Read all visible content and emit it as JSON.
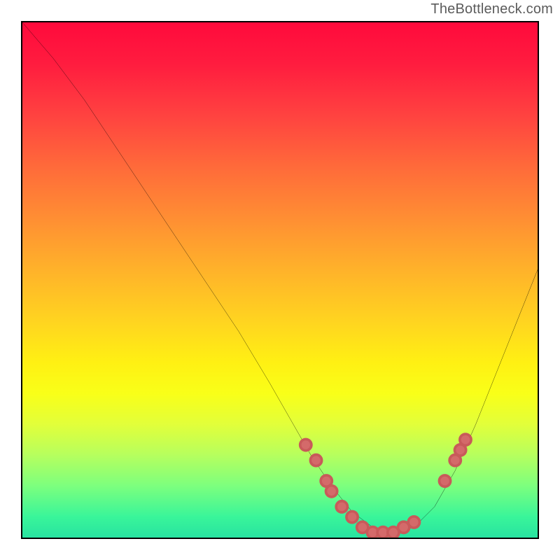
{
  "watermark": "TheBottleneck.com",
  "chart_data": {
    "type": "line",
    "title": "",
    "xlabel": "",
    "ylabel": "",
    "xlim": [
      0,
      100
    ],
    "ylim": [
      0,
      100
    ],
    "grid": false,
    "legend": false,
    "series": [
      {
        "name": "curve",
        "x": [
          0,
          6,
          12,
          18,
          24,
          30,
          36,
          42,
          48,
          52,
          56,
          60,
          64,
          68,
          72,
          76,
          80,
          84,
          88,
          92,
          96,
          100
        ],
        "y": [
          100,
          93,
          85,
          76,
          67,
          58,
          49,
          40,
          30,
          23,
          16,
          10,
          5,
          2,
          1,
          2,
          6,
          13,
          22,
          32,
          42,
          52
        ]
      }
    ],
    "scatter": {
      "name": "dots",
      "x": [
        55,
        57,
        59,
        60,
        62,
        64,
        66,
        68,
        70,
        72,
        74,
        76,
        82,
        84,
        85,
        86
      ],
      "y": [
        18,
        15,
        11,
        9,
        6,
        4,
        2,
        1,
        1,
        1,
        2,
        3,
        11,
        15,
        17,
        19
      ]
    },
    "background_gradient": {
      "stops": [
        {
          "pos": 0.0,
          "color": "#ff0a3c"
        },
        {
          "pos": 0.5,
          "color": "#ffd420"
        },
        {
          "pos": 0.72,
          "color": "#f9ff18"
        },
        {
          "pos": 0.9,
          "color": "#7cff7e"
        },
        {
          "pos": 1.0,
          "color": "#28e3a0"
        }
      ]
    }
  }
}
